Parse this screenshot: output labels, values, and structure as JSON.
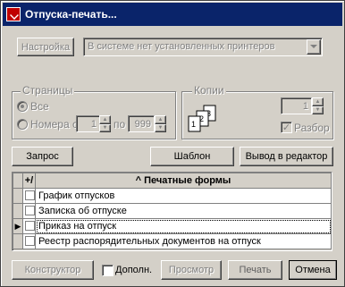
{
  "window": {
    "title": "Отпуска-печать..."
  },
  "printer": {
    "setup_label": "Настройка",
    "selected": "В системе нет установленных принтеров"
  },
  "pages": {
    "group_label": "Страницы",
    "all_label": "Все",
    "range_label": "Номера с",
    "from_value": "1",
    "to_label": "по",
    "to_value": "999"
  },
  "copies": {
    "group_label": "Копии",
    "count": "1",
    "collate_label": "Разбор",
    "collate_checked": true
  },
  "actions": {
    "query_label": "Запрос",
    "template_label": "Шаблон",
    "editor_label": "Вывод в редактор"
  },
  "forms_table": {
    "col_check": "+/",
    "col_name": "^ Печатные формы",
    "rows": [
      {
        "name": "График отпусков",
        "checked": false,
        "current": false
      },
      {
        "name": "Записка об отпуске",
        "checked": false,
        "current": false
      },
      {
        "name": "Приказ на отпуск",
        "checked": false,
        "current": true
      },
      {
        "name": "Реестр распорядительных документов на отпуск",
        "checked": false,
        "current": false
      }
    ]
  },
  "footer": {
    "constructor_label": "Конструктор",
    "extra_label": "Дополн.",
    "preview_label": "Просмотр",
    "print_label": "Печать",
    "cancel_label": "Отмена"
  }
}
